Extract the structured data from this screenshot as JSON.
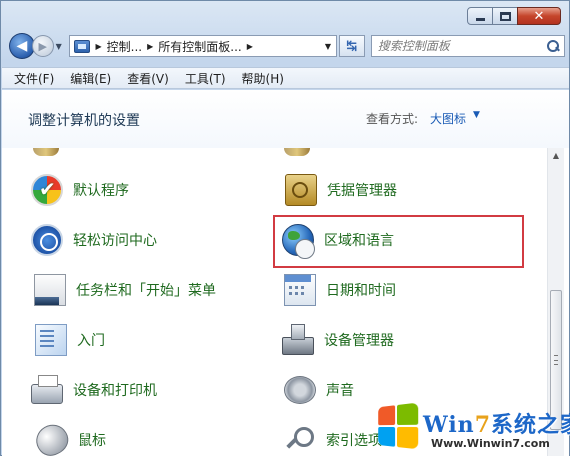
{
  "nav": {
    "address_crumbs": [
      "控制...",
      "所有控制面板..."
    ],
    "search_placeholder": "搜索控制面板"
  },
  "menu": [
    "文件(F)",
    "编辑(E)",
    "查看(V)",
    "工具(T)",
    "帮助(H)"
  ],
  "header": {
    "title": "调整计算机的设置",
    "view_by_label": "查看方式:",
    "view_by_value": "大图标"
  },
  "left_items": [
    {
      "label": "默认程序",
      "icon": "default-programs-icon"
    },
    {
      "label": "轻松访问中心",
      "icon": "ease-of-access-icon"
    },
    {
      "label": "任务栏和「开始」菜单",
      "icon": "taskbar-icon"
    },
    {
      "label": "入门",
      "icon": "getting-started-icon"
    },
    {
      "label": "设备和打印机",
      "icon": "printer-icon"
    },
    {
      "label": "鼠标",
      "icon": "mouse-icon"
    }
  ],
  "right_items": [
    {
      "label": "凭据管理器",
      "icon": "credential-vault-icon"
    },
    {
      "label": "区域和语言",
      "icon": "region-globe-icon"
    },
    {
      "label": "日期和时间",
      "icon": "calendar-icon"
    },
    {
      "label": "设备管理器",
      "icon": "device-manager-icon"
    },
    {
      "label": "声音",
      "icon": "speaker-icon"
    },
    {
      "label": "索引选项",
      "icon": "magnifier-icon"
    }
  ],
  "highlighted_item": "区域和语言",
  "highlight_color": "#d23b42",
  "link_color": "#1f6a1f",
  "watermark": {
    "title_main": "Win",
    "title_digit": "7",
    "title_rest": "系统之家",
    "url": "Www.Winwin7.com"
  }
}
